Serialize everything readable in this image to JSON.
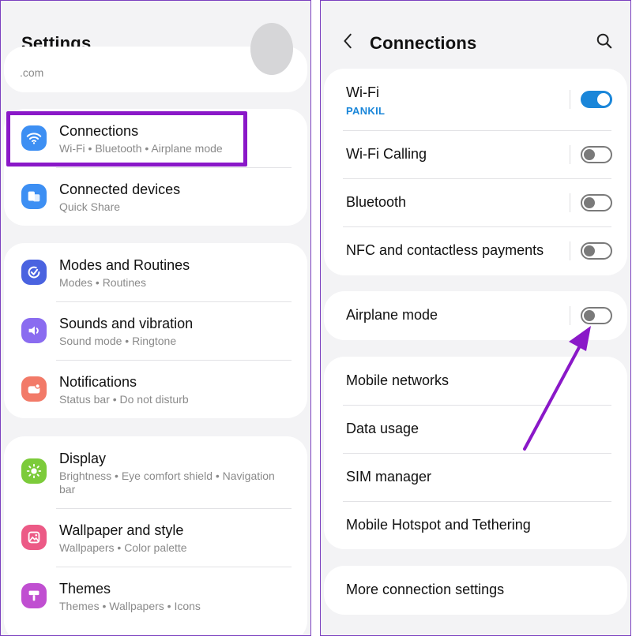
{
  "left": {
    "title": "Settings",
    "account_partial": ".com",
    "groups": [
      [
        {
          "key": "connections",
          "label": "Connections",
          "sub": [
            "Wi-Fi",
            "Bluetooth",
            "Airplane mode"
          ],
          "icon": "wifi-icon",
          "color": "#3d8ff3"
        },
        {
          "key": "connected-devices",
          "label": "Connected devices",
          "sub": [
            "Quick Share"
          ],
          "icon": "devices-icon",
          "color": "#3d8ff3"
        }
      ],
      [
        {
          "key": "modes-routines",
          "label": "Modes and Routines",
          "sub": [
            "Modes",
            "Routines"
          ],
          "icon": "check-circle-icon",
          "color": "#4a63e0"
        },
        {
          "key": "sounds-vibration",
          "label": "Sounds and vibration",
          "sub": [
            "Sound mode",
            "Ringtone"
          ],
          "icon": "speaker-icon",
          "color": "#8a6cf0"
        },
        {
          "key": "notifications",
          "label": "Notifications",
          "sub": [
            "Status bar",
            "Do not disturb"
          ],
          "icon": "notification-icon",
          "color": "#f27a68"
        }
      ],
      [
        {
          "key": "display",
          "label": "Display",
          "sub": [
            "Brightness",
            "Eye comfort shield",
            "Navigation"
          ],
          "sub2": "bar",
          "icon": "sun-icon",
          "color": "#7ccb3a"
        },
        {
          "key": "wallpaper-style",
          "label": "Wallpaper and style",
          "sub": [
            "Wallpapers",
            "Color palette"
          ],
          "icon": "image-icon",
          "color": "#ec5a86"
        },
        {
          "key": "themes",
          "label": "Themes",
          "sub": [
            "Themes",
            "Wallpapers",
            "Icons"
          ],
          "icon": "brush-icon",
          "color": "#c04fd1"
        }
      ]
    ]
  },
  "right": {
    "title": "Connections",
    "groups": [
      [
        {
          "key": "wifi",
          "label": "Wi-Fi",
          "sub": "PANKIL",
          "toggle": true,
          "on": true
        },
        {
          "key": "wifi-calling",
          "label": "Wi-Fi Calling",
          "toggle": true,
          "on": false
        },
        {
          "key": "bluetooth",
          "label": "Bluetooth",
          "toggle": true,
          "on": false
        },
        {
          "key": "nfc",
          "label": "NFC and contactless payments",
          "toggle": true,
          "on": false
        }
      ],
      [
        {
          "key": "airplane",
          "label": "Airplane mode",
          "toggle": true,
          "on": false
        }
      ],
      [
        {
          "key": "mobile-networks",
          "label": "Mobile networks",
          "toggle": false
        },
        {
          "key": "data-usage",
          "label": "Data usage",
          "toggle": false
        },
        {
          "key": "sim-manager",
          "label": "SIM manager",
          "toggle": false
        },
        {
          "key": "hotspot",
          "label": "Mobile Hotspot and Tethering",
          "toggle": false
        }
      ],
      [
        {
          "key": "more-connection",
          "label": "More connection settings",
          "toggle": false
        }
      ]
    ]
  },
  "colors": {
    "highlight": "#8a18c8",
    "arrow": "#8a18c8",
    "toggle_on": "#1a86d9",
    "wifi_ssid": "#1a86d9"
  }
}
